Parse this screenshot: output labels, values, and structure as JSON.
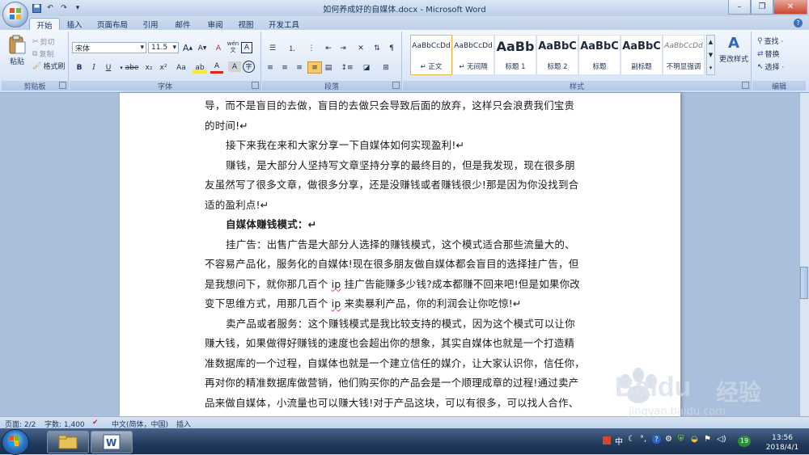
{
  "window": {
    "title": "如何养成好的自媒体.docx - Microsoft Word",
    "controls": {
      "minimize": "–",
      "restore": "❐",
      "close": "✕"
    }
  },
  "tabs": [
    "开始",
    "插入",
    "页面布局",
    "引用",
    "邮件",
    "审阅",
    "视图",
    "开发工具"
  ],
  "clipboard": {
    "paste": "粘贴",
    "cut": "剪切",
    "copy": "复制",
    "format_painter": "格式刷",
    "label": "剪贴板"
  },
  "font": {
    "family": "宋体",
    "size": "11.5",
    "label": "字体",
    "bold": "B",
    "italic": "I",
    "underline": "U",
    "strike": "abe",
    "subscript": "x₂",
    "superscript": "x²",
    "case": "Aa",
    "grow": "A",
    "shrink": "A",
    "wen": "wén",
    "wen_char": "文",
    "clear": "A",
    "border_char": "A",
    "circle_char": "字",
    "highlight": "ab",
    "color": "A",
    "shading": "A"
  },
  "paragraph": {
    "label": "段落"
  },
  "styles": {
    "label": "样式",
    "items": [
      {
        "preview": "AaBbCcDd",
        "name": "↵ 正文"
      },
      {
        "preview": "AaBbCcDd",
        "name": "↵ 无间隔"
      },
      {
        "preview": "AaBb",
        "name": "标题 1"
      },
      {
        "preview": "AaBbC",
        "name": "标题 2"
      },
      {
        "preview": "AaBbC",
        "name": "标题"
      },
      {
        "preview": "AaBbC",
        "name": "副标题"
      },
      {
        "preview": "AaBbCcDd",
        "name": "不明显强调"
      }
    ],
    "change_styles": "更改样式"
  },
  "editing": {
    "label": "编辑",
    "find": "查找 ·",
    "replace": "替换",
    "select": "选择 ·"
  },
  "document": {
    "lines": [
      {
        "text": "导，而不是盲目的去做，盲目的去做只会导致后面的放弃，这样只会浪费我们宝贵",
        "indent": false,
        "heading": false
      },
      {
        "text": "的时间!↵",
        "indent": false,
        "heading": false
      },
      {
        "text": "接下来我在来和大家分享一下自媒体如何实现盈利!↵",
        "indent": true,
        "heading": false
      },
      {
        "text": "赚钱，是大部分人坚持写文章坚持分享的最终目的，但是我发现，现在很多朋",
        "indent": true,
        "heading": false
      },
      {
        "text": "友虽然写了很多文章，做很多分享，还是没赚钱或者赚钱很少!那是因为你没找到合",
        "indent": false,
        "heading": false
      },
      {
        "text": "适的盈利点!↵",
        "indent": false,
        "heading": false
      },
      {
        "text": "自媒体赚钱模式：↵",
        "indent": true,
        "heading": true
      },
      {
        "text": "挂广告：出售广告是大部分人选择的赚钱模式，这个模式适合那些流量大的、",
        "indent": true,
        "heading": false
      },
      {
        "text": "不容易产品化，服务化的自媒体!现在很多朋友做自媒体都会盲目的选择挂广告，但",
        "indent": false,
        "heading": false
      },
      {
        "text": "是我想问下，就你那几百个 ip 挂广告能赚多少钱?成本都赚不回来吧!但是如果你改",
        "indent": false,
        "heading": false
      },
      {
        "text": "变下思维方式，用那几百个 ip 来卖暴利产品，你的利润会让你吃惊!↵",
        "indent": false,
        "heading": false
      },
      {
        "text": "卖产品或者服务：这个赚钱模式是我比较支持的模式，因为这个模式可以让你",
        "indent": true,
        "heading": false
      },
      {
        "text": "赚大钱，如果做得好赚钱的速度也会超出你的想象，其实自媒体也就是一个打造精",
        "indent": false,
        "heading": false
      },
      {
        "text": "准数据库的一个过程，自媒体也就是一个建立信任的媒介，让大家认识你，信任你，",
        "indent": false,
        "heading": false
      },
      {
        "text": "再对你的精准数据库做营销，他们购买你的产品会是一个顺理成章的过程!通过卖产",
        "indent": false,
        "heading": false
      },
      {
        "text": "品来做自媒体，小流量也可以赚大钱!对于产品这块，可以有很多，可以找人合作、",
        "indent": false,
        "heading": false
      }
    ]
  },
  "status": {
    "page": "页面: 2/2",
    "words": "字数: 1,400",
    "language": "中文(简体，中国)",
    "mode": "插入"
  },
  "taskbar": {
    "ime": "中",
    "badge": "19",
    "time": "13:56",
    "date": "2018/4/1"
  },
  "watermark": {
    "brand": "Baidu",
    "text": "经验",
    "url": "jingyan.baidu.com"
  }
}
